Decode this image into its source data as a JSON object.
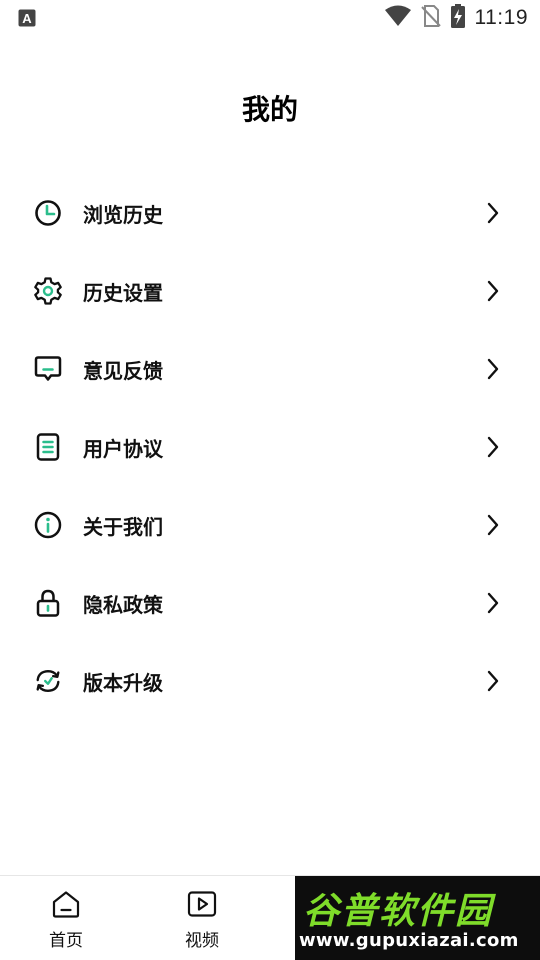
{
  "status_bar": {
    "time": "11:19",
    "left_icon": "a-keyboard-icon",
    "right_icons": [
      "wifi-icon",
      "no-sim-icon",
      "battery-charging-icon"
    ]
  },
  "header": {
    "title": "我的"
  },
  "menu": {
    "items": [
      {
        "label": "浏览历史",
        "icon": "clock-icon"
      },
      {
        "label": "历史设置",
        "icon": "gear-icon"
      },
      {
        "label": "意见反馈",
        "icon": "feedback-icon"
      },
      {
        "label": "用户协议",
        "icon": "document-icon"
      },
      {
        "label": "关于我们",
        "icon": "info-icon"
      },
      {
        "label": "隐私政策",
        "icon": "lock-icon"
      },
      {
        "label": "版本升级",
        "icon": "refresh-icon"
      }
    ],
    "accent_color": "#2bbd8c"
  },
  "bottom_nav": {
    "tabs": [
      {
        "label": "首页",
        "icon": "home-icon"
      },
      {
        "label": "视频",
        "icon": "video-play-icon"
      }
    ]
  },
  "watermark": {
    "brand": "谷普软件园",
    "url": "www.gupuxiazai.com"
  }
}
